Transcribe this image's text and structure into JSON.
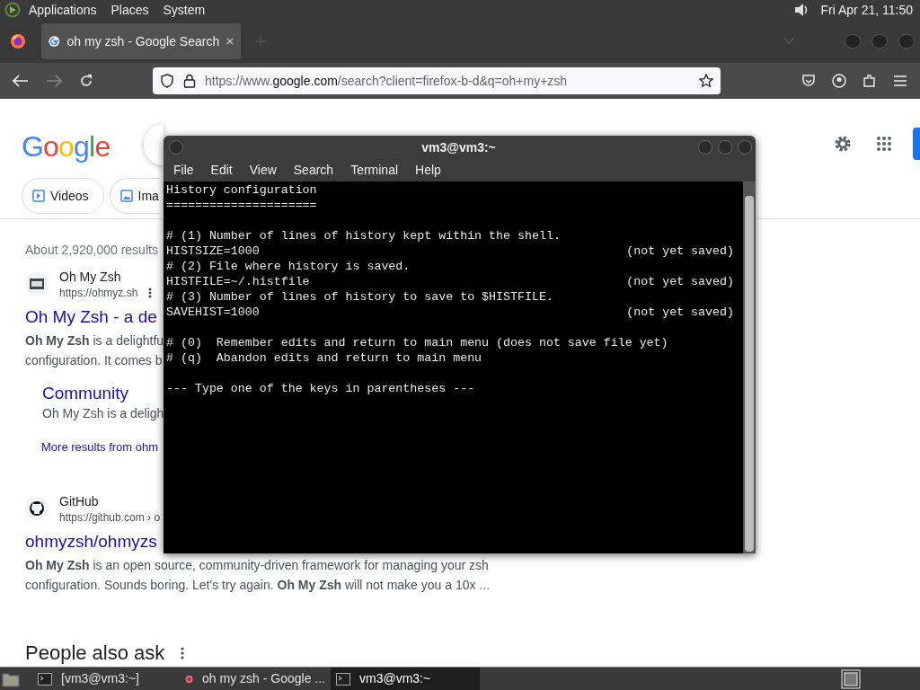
{
  "top_panel": {
    "menus": [
      "Applications",
      "Places",
      "System"
    ],
    "clock": "Fri Apr 21, 11:50"
  },
  "browser": {
    "tab": {
      "title": "oh my zsh - Google Search",
      "selected": true
    },
    "url": {
      "prefix": "https://www.",
      "domain": "google.com",
      "rest": "/search?client=firefox-b-d&q=oh+my+zsh"
    },
    "page": {
      "logo": "Google",
      "chips": [
        "Videos",
        "Ima"
      ],
      "result_count": "About 2,920,000 results",
      "results": [
        {
          "kind": "ohmyzsh",
          "site": "Oh My Zsh",
          "url": "https://ohmyz.sh",
          "title": "Oh My Zsh - a de",
          "snippet": [
            "**Oh My Zsh** is a delightfu",
            "configuration. It comes b"
          ],
          "sublink": {
            "title": "Community",
            "snippet": "Oh My Zsh is a deligh"
          },
          "more": "More results from ohm"
        },
        {
          "kind": "github",
          "site": "GitHub",
          "url": "https://github.com › o",
          "title": "ohmyzsh/ohmyzs",
          "snippet": [
            "**Oh My Zsh** is an open source, community-driven framework for managing your zsh",
            "configuration. Sounds boring. Let's try again. **Oh My Zsh** will not make you a 10x ..."
          ]
        }
      ],
      "people_also_ask": "People also ask"
    }
  },
  "terminal": {
    "title": "vm3@vm3:~",
    "menu": [
      "File",
      "Edit",
      "View",
      "Search",
      "Terminal",
      "Help"
    ],
    "lines": [
      {
        "kind": "line",
        "text": "History configuration"
      },
      {
        "kind": "line",
        "text": "====================="
      },
      {
        "kind": "blank"
      },
      {
        "kind": "line",
        "text": "# (1) Number of lines of history kept within the shell."
      },
      {
        "kind": "line",
        "text": "HISTSIZE=1000",
        "note": "(not yet saved)"
      },
      {
        "kind": "line",
        "text": "# (2) File where history is saved."
      },
      {
        "kind": "line",
        "text": "HISTFILE=~/.histfile",
        "note": "(not yet saved)"
      },
      {
        "kind": "line",
        "text": "# (3) Number of lines of history to save to $HISTFILE."
      },
      {
        "kind": "line",
        "text": "SAVEHIST=1000",
        "note": "(not yet saved)"
      },
      {
        "kind": "blank"
      },
      {
        "kind": "line",
        "text": "# (0)  Remember edits and return to main menu (does not save file yet)"
      },
      {
        "kind": "line",
        "text": "# (q)  Abandon edits and return to main menu"
      },
      {
        "kind": "blank"
      },
      {
        "kind": "line",
        "text": "--- Type one of the keys in parentheses ---"
      }
    ]
  },
  "taskbar": {
    "items": [
      {
        "kind": "terminal",
        "label": "[vm3@vm3:~]",
        "selected": false
      },
      {
        "kind": "firefox",
        "label": "oh my zsh - Google ...",
        "selected": false
      },
      {
        "kind": "terminal",
        "label": "vm3@vm3:~",
        "selected": true
      }
    ]
  }
}
